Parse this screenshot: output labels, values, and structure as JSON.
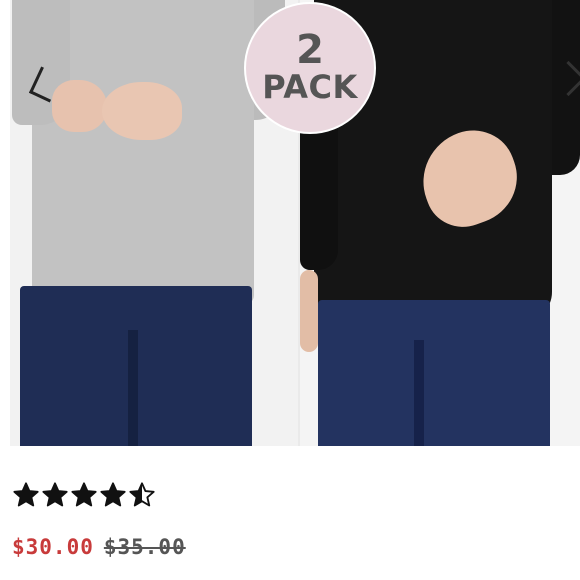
{
  "badge": {
    "number": "2",
    "text": "PACK",
    "background": "#ead7de",
    "text_color": "#555555"
  },
  "rating": {
    "value": 4.5,
    "max": 5,
    "icon": "star-icon",
    "color": "#111111"
  },
  "price": {
    "current": "$30.00",
    "original": "$35.00",
    "current_color": "#c83b3b",
    "original_color": "#555555"
  }
}
